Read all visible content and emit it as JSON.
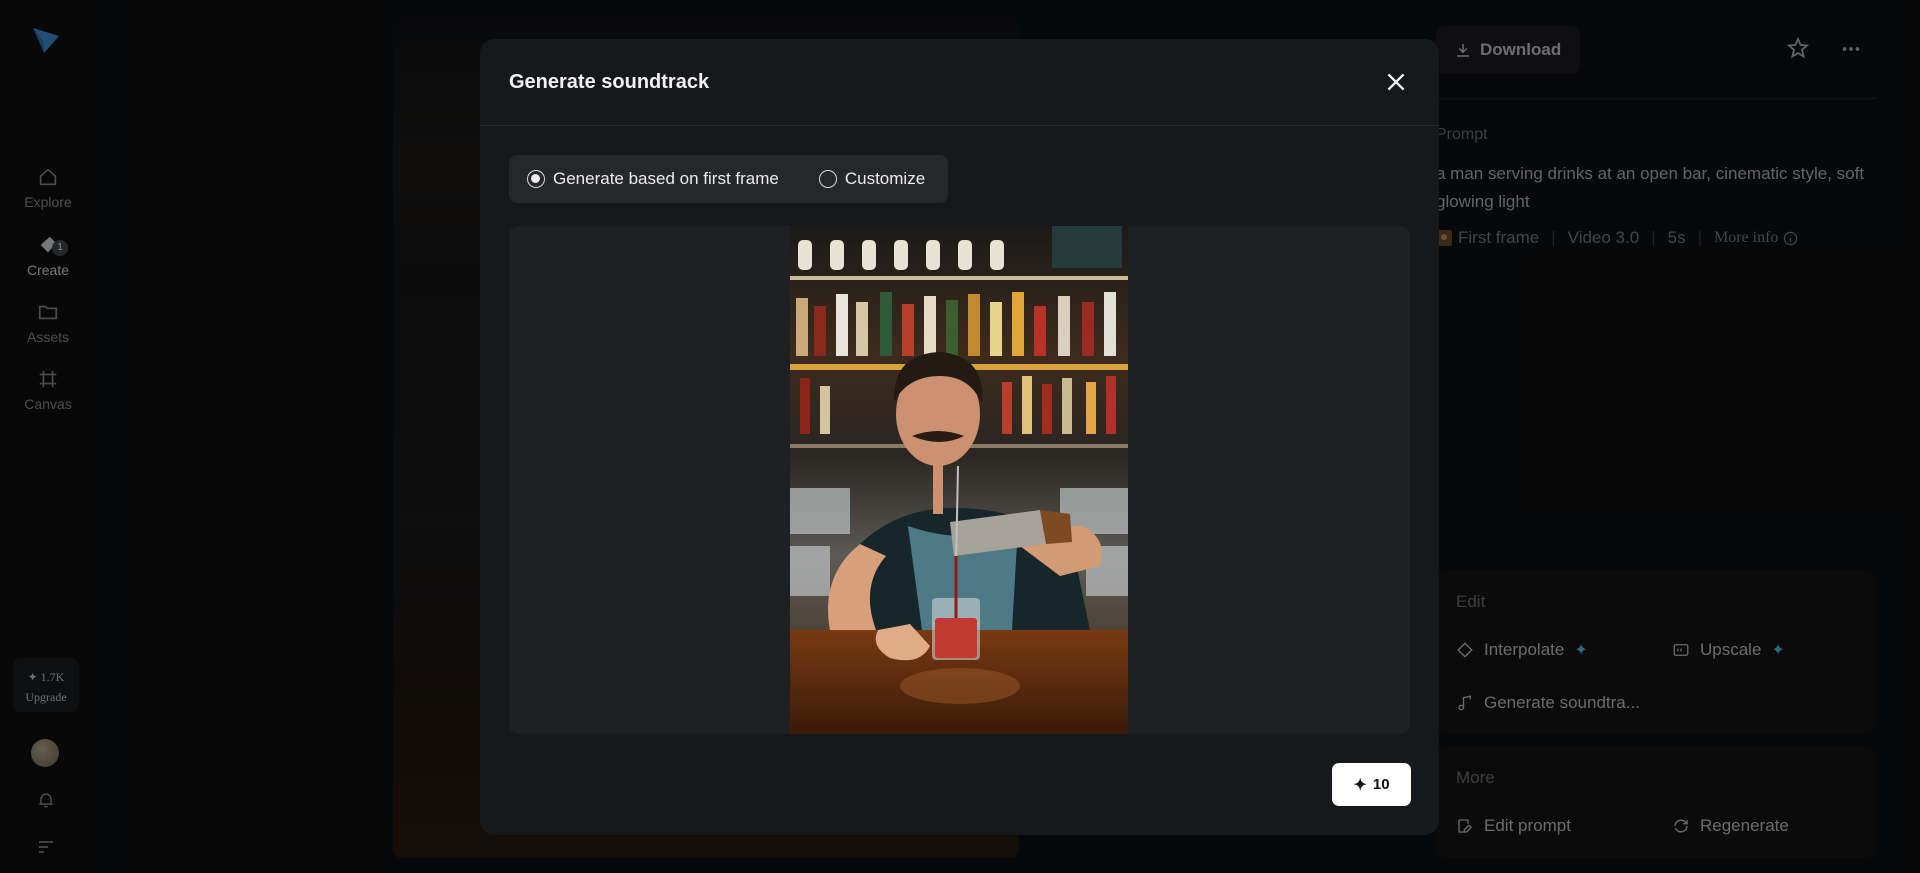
{
  "sidebar": {
    "nav": [
      {
        "label": "Explore",
        "icon": "home-icon"
      },
      {
        "label": "Create",
        "icon": "create-icon",
        "badge": "1"
      },
      {
        "label": "Assets",
        "icon": "folder-icon"
      },
      {
        "label": "Canvas",
        "icon": "canvas-icon"
      }
    ],
    "credits": "✦ 1.7K",
    "upgrade": "Upgrade"
  },
  "right_panel": {
    "download": "Download",
    "prompt_label": "Prompt",
    "prompt_text": "a man serving drinks at an open bar, cinematic style, soft glowing light",
    "meta": {
      "first_frame": "First frame",
      "model": "Video 3.0",
      "duration": "5s",
      "more_info": "More info"
    },
    "edit_section": {
      "title": "Edit",
      "interpolate": "Interpolate",
      "upscale": "Upscale",
      "generate_soundtrack": "Generate soundtra..."
    },
    "more_section": {
      "title": "More",
      "edit_prompt": "Edit prompt",
      "regenerate": "Regenerate"
    }
  },
  "modal": {
    "title": "Generate soundtrack",
    "options": [
      {
        "label": "Generate based on first frame",
        "checked": true
      },
      {
        "label": "Customize",
        "checked": false
      }
    ],
    "generate_cost": "10"
  },
  "colors": {
    "accent": "#4fc3d9",
    "background": "#0e0f11",
    "modal": "#17181b"
  }
}
